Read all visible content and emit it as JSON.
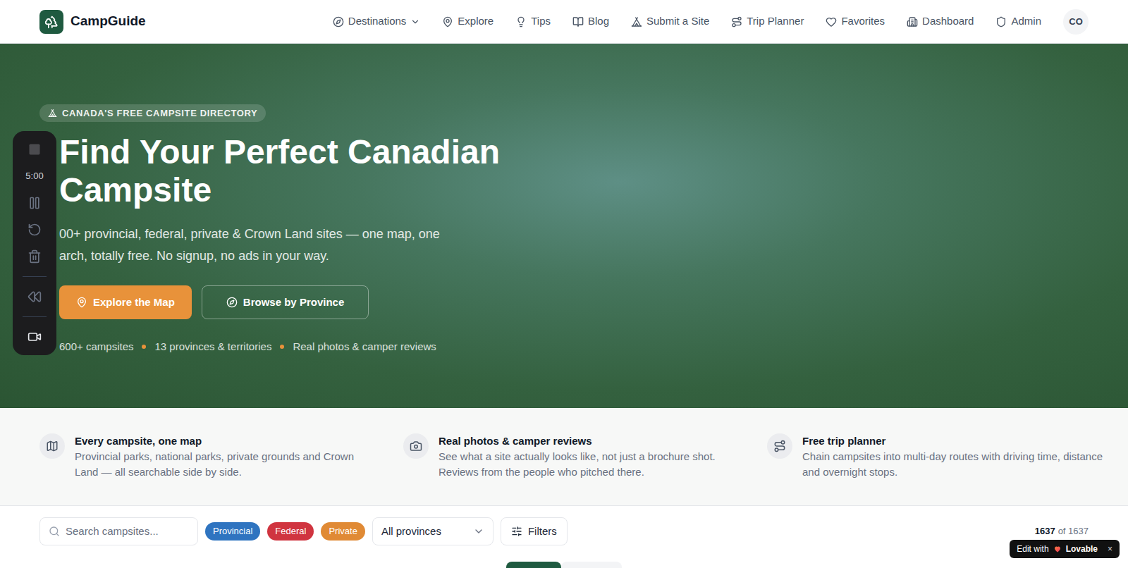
{
  "header": {
    "brand": "CampGuide",
    "nav": [
      {
        "label": "Destinations",
        "dropdown": true
      },
      {
        "label": "Explore",
        "dropdown": false
      },
      {
        "label": "Tips",
        "dropdown": false
      },
      {
        "label": "Blog",
        "dropdown": false
      },
      {
        "label": "Submit a Site",
        "dropdown": false
      },
      {
        "label": "Trip Planner",
        "dropdown": false
      },
      {
        "label": "Favorites",
        "dropdown": false
      },
      {
        "label": "Dashboard",
        "dropdown": false
      },
      {
        "label": "Admin",
        "dropdown": false
      }
    ],
    "avatar": "CO"
  },
  "hero": {
    "badge": "CANADA'S FREE CAMPSITE DIRECTORY",
    "title_lines": [
      "Find Your Perfect Canadian",
      "Campsite"
    ],
    "subtitle_lines": [
      "00+ provincial, federal, private & Crown Land sites — one map, one",
      "arch, totally free. No signup, no ads in your way."
    ],
    "primary_button": "Explore the Map",
    "secondary_button": "Browse by Province",
    "stats": [
      "600+ campsites",
      "13 provinces & territories",
      "Real photos & camper reviews"
    ]
  },
  "recorder": {
    "time": "5:00"
  },
  "features": [
    {
      "title": "Every campsite, one map",
      "description": "Provincial parks, national parks, private grounds and Crown Land — all searchable side by side."
    },
    {
      "title": "Real photos & camper reviews",
      "description": "See what a site actually looks like, not just a brochure shot. Reviews from the people who pitched there."
    },
    {
      "title": "Free trip planner",
      "description": "Chain campsites into multi-day routes with driving time, distance and overnight stops."
    }
  ],
  "filters": {
    "search_placeholder": "Search campsites...",
    "tags": [
      {
        "label": "Provincial",
        "color": "#2f74c0"
      },
      {
        "label": "Federal",
        "color": "#d0343f"
      },
      {
        "label": "Private",
        "color": "#e08a35"
      }
    ],
    "province": "All provinces",
    "filters_button": "Filters",
    "count": "1637",
    "count_total": "of 1637"
  },
  "lovable": {
    "prefix": "Edit with",
    "brand": "Lovable",
    "close": "×"
  }
}
